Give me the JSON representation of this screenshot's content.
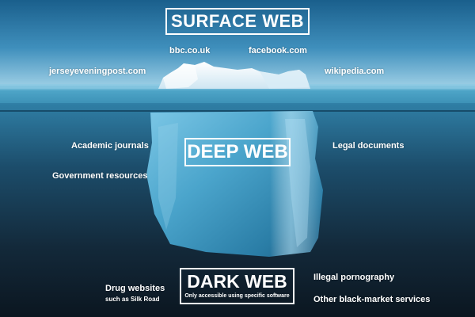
{
  "diagram": {
    "surface_web": {
      "title": "SURFACE WEB",
      "examples": [
        "bbc.co.uk",
        "facebook.com",
        "jerseyeveningpost.com",
        "wikipedia.com"
      ]
    },
    "deep_web": {
      "title": "DEEP WEB",
      "examples": [
        "Academic journals",
        "Government resources",
        "Legal documents"
      ]
    },
    "dark_web": {
      "title": "DARK WEB",
      "subtitle": "Only accessible using specific software",
      "examples": [
        "Drug websites",
        "such as Silk Road",
        "Illegal pornography",
        "Other black-market services"
      ]
    }
  },
  "colors": {
    "sky_top": "#1a5f8c",
    "sky_horizon": "#9fd0e6",
    "water_surface": "#5fb4d4",
    "deep_water": "#1c3d55",
    "abyss": "#0b1620",
    "ice": "#e8f4fb",
    "ice_underwater": "#4ba5cc",
    "label_text": "#ffffff"
  }
}
